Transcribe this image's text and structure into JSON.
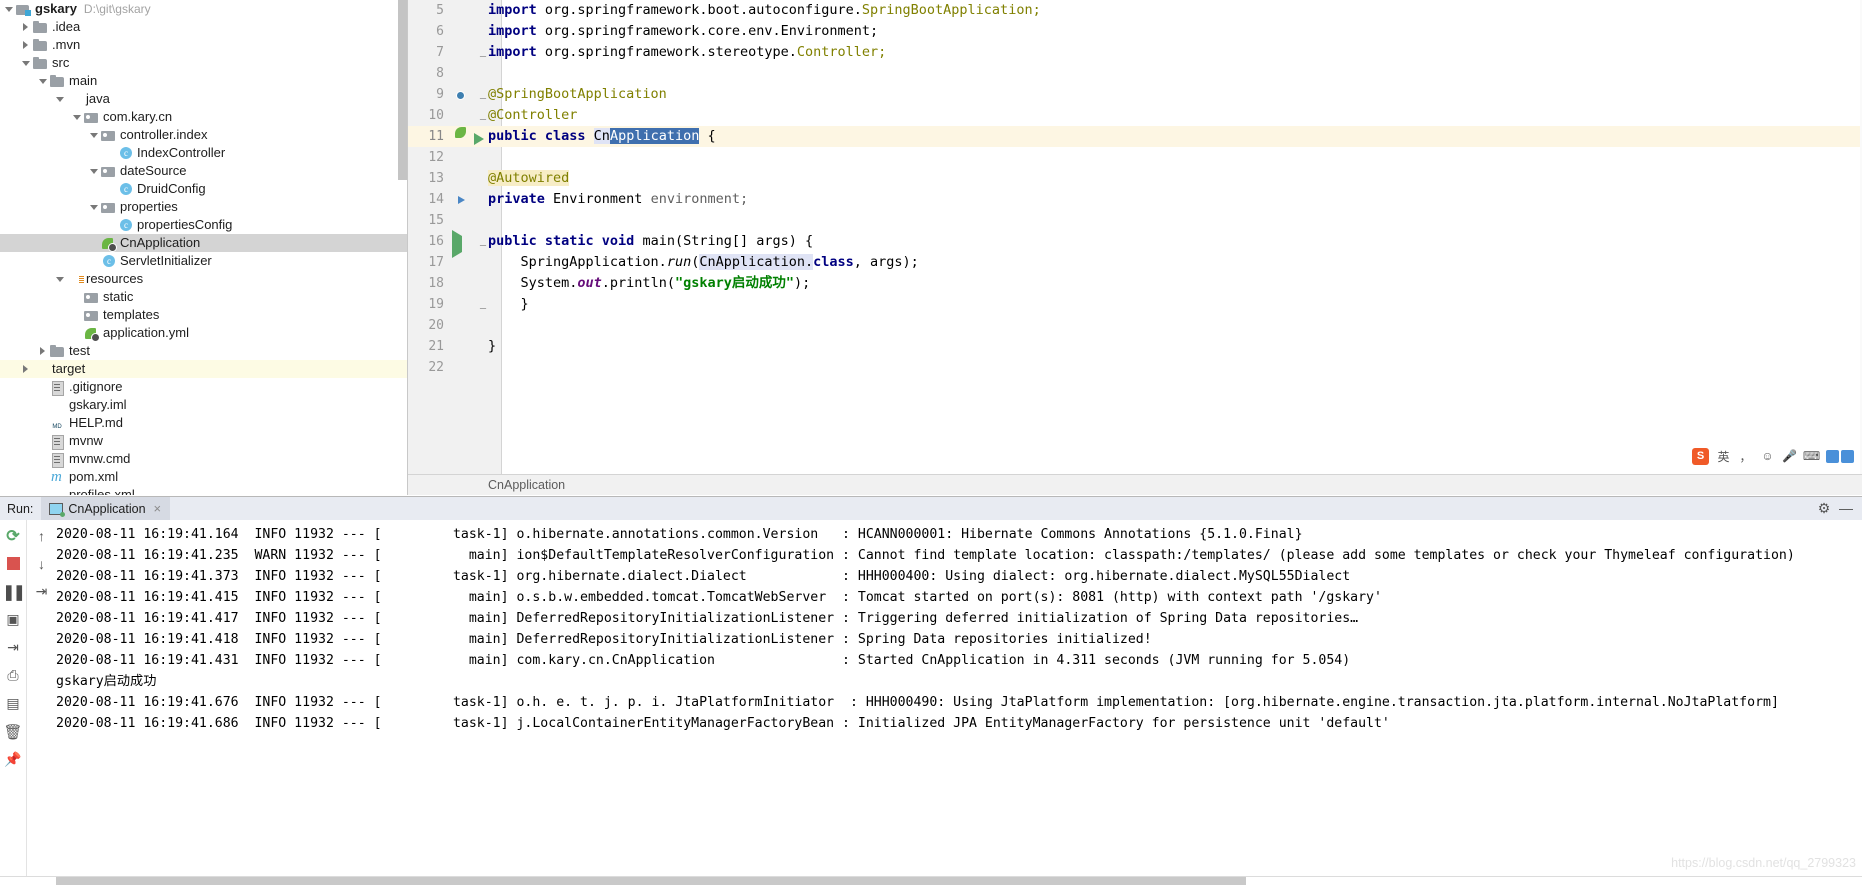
{
  "project": {
    "root_label": "gskary",
    "root_path": "D:\\git\\gskary",
    "items": [
      {
        "label": ".idea",
        "indent": 1,
        "arrow": "right",
        "icon": "folder",
        "state": "normal"
      },
      {
        "label": ".mvn",
        "indent": 1,
        "arrow": "right",
        "icon": "folder",
        "state": "normal"
      },
      {
        "label": "src",
        "indent": 1,
        "arrow": "down",
        "icon": "folder",
        "state": "normal"
      },
      {
        "label": "main",
        "indent": 2,
        "arrow": "down",
        "icon": "folder",
        "state": "normal"
      },
      {
        "label": "java",
        "indent": 3,
        "arrow": "down",
        "icon": "folder-src",
        "state": "normal"
      },
      {
        "label": "com.kary.cn",
        "indent": 4,
        "arrow": "down",
        "icon": "folder-pkg",
        "state": "normal"
      },
      {
        "label": "controller.index",
        "indent": 5,
        "arrow": "down",
        "icon": "folder-pkg",
        "state": "normal"
      },
      {
        "label": "IndexController",
        "indent": 6,
        "arrow": "none",
        "icon": "class",
        "state": "normal"
      },
      {
        "label": "dateSource",
        "indent": 5,
        "arrow": "down",
        "icon": "folder-pkg",
        "state": "normal"
      },
      {
        "label": "DruidConfig",
        "indent": 6,
        "arrow": "none",
        "icon": "class",
        "state": "normal"
      },
      {
        "label": "properties",
        "indent": 5,
        "arrow": "down",
        "icon": "folder-pkg",
        "state": "normal"
      },
      {
        "label": "propertiesConfig",
        "indent": 6,
        "arrow": "none",
        "icon": "class",
        "state": "normal"
      },
      {
        "label": "CnApplication",
        "indent": 5,
        "arrow": "none",
        "icon": "spring",
        "state": "selected"
      },
      {
        "label": "ServletInitializer",
        "indent": 5,
        "arrow": "none",
        "icon": "class",
        "state": "normal"
      },
      {
        "label": "resources",
        "indent": 3,
        "arrow": "down",
        "icon": "folder-res",
        "state": "normal"
      },
      {
        "label": "static",
        "indent": 4,
        "arrow": "none",
        "icon": "folder-pkg",
        "state": "normal"
      },
      {
        "label": "templates",
        "indent": 4,
        "arrow": "none",
        "icon": "folder-pkg",
        "state": "normal"
      },
      {
        "label": "application.yml",
        "indent": 4,
        "arrow": "none",
        "icon": "yml",
        "state": "normal"
      },
      {
        "label": "test",
        "indent": 2,
        "arrow": "right",
        "icon": "folder",
        "state": "normal"
      },
      {
        "label": "target",
        "indent": 1,
        "arrow": "right",
        "icon": "folder-target",
        "state": "highlight"
      },
      {
        "label": ".gitignore",
        "indent": 2,
        "arrow": "none",
        "icon": "file",
        "state": "normal"
      },
      {
        "label": "gskary.iml",
        "indent": 2,
        "arrow": "none",
        "icon": "file-iml",
        "state": "normal"
      },
      {
        "label": "HELP.md",
        "indent": 2,
        "arrow": "none",
        "icon": "file-md",
        "icon_text": "MD",
        "state": "normal"
      },
      {
        "label": "mvnw",
        "indent": 2,
        "arrow": "none",
        "icon": "file",
        "state": "normal"
      },
      {
        "label": "mvnw.cmd",
        "indent": 2,
        "arrow": "none",
        "icon": "file",
        "state": "normal"
      },
      {
        "label": "pom.xml",
        "indent": 2,
        "arrow": "none",
        "icon": "maven",
        "state": "normal"
      },
      {
        "label": "profiles.xml",
        "indent": 2,
        "arrow": "none",
        "icon": "file-xml",
        "icon_text": "<>",
        "state": "normal"
      }
    ]
  },
  "editor": {
    "breadcrumb": "CnApplication",
    "lines": [
      {
        "num": "5",
        "marker": "",
        "fold": "",
        "highlight": false
      },
      {
        "num": "6",
        "marker": "",
        "fold": "",
        "highlight": false
      },
      {
        "num": "7",
        "marker": "",
        "fold": "-",
        "highlight": false
      },
      {
        "num": "8",
        "marker": "",
        "fold": "",
        "highlight": false
      },
      {
        "num": "9",
        "marker": "bean",
        "fold": "-",
        "highlight": false
      },
      {
        "num": "10",
        "marker": "",
        "fold": "-",
        "highlight": false
      },
      {
        "num": "11",
        "marker": "spring-run",
        "fold": "",
        "highlight": true
      },
      {
        "num": "12",
        "marker": "",
        "fold": "",
        "highlight": false
      },
      {
        "num": "13",
        "marker": "",
        "fold": "",
        "highlight": false
      },
      {
        "num": "14",
        "marker": "autowire",
        "fold": "",
        "highlight": false
      },
      {
        "num": "15",
        "marker": "",
        "fold": "",
        "highlight": false
      },
      {
        "num": "16",
        "marker": "play",
        "fold": "-",
        "highlight": false
      },
      {
        "num": "17",
        "marker": "",
        "fold": "",
        "highlight": false
      },
      {
        "num": "18",
        "marker": "",
        "fold": "",
        "highlight": false
      },
      {
        "num": "19",
        "marker": "",
        "fold": "-",
        "highlight": false
      },
      {
        "num": "20",
        "marker": "",
        "fold": "",
        "highlight": false
      },
      {
        "num": "21",
        "marker": "",
        "fold": "",
        "highlight": false
      },
      {
        "num": "22",
        "marker": "",
        "fold": "",
        "highlight": false
      }
    ],
    "code": {
      "l5_kw": "import",
      "l5_pkg": " org.springframework.boot.autoconfigure.",
      "l5_cls": "SpringBootApplication;",
      "l6_kw": "import",
      "l6_pkg": " org.springframework.core.env.",
      "l6_cls": "Environment;",
      "l7_kw": "import",
      "l7_pkg": " org.springframework.stereotype.",
      "l7_cls": "Controller;",
      "l9_ann": "@SpringBootApplication",
      "l10_ann": "@Controller",
      "l11_kw": "public class ",
      "l11_name_pre": "Cn",
      "l11_name_sel": "Application",
      "l11_brace": " {",
      "l13_ann": "@Autowired",
      "l14_kw": "private ",
      "l14_type": "Environment ",
      "l14_var": "environment;",
      "l16_kw": "public static void ",
      "l16_sig": "main(String[] args) {",
      "l17_a": "    SpringApplication.",
      "l17_run": "run",
      "l17_b": "(",
      "l17_cls": "CnApplication.",
      "l17_kw": "class",
      "l17_c": ", args);",
      "l18_a": "    System.",
      "l18_out": "out",
      "l18_b": ".println(",
      "l18_str": "\"gskary启动成功\"",
      "l18_c": ");",
      "l19": "    }",
      "l21": "}"
    },
    "ime": {
      "logo": "S",
      "mode_label": "英",
      "punct": "，",
      "emoji": "☺",
      "mic": "🎤",
      "keyboard": "⌨",
      "tools": "▦"
    }
  },
  "run_panel": {
    "run_label": "Run:",
    "tab_label": "CnApplication",
    "tab_close": "×",
    "gear": "⚙",
    "minimize": "—",
    "toolbar": {
      "rerun": "⟳",
      "stop": "■",
      "pause": "❚❚",
      "camera": "▣",
      "export": "⇥",
      "print": "⎙",
      "grid": "▤",
      "trash": "🗑",
      "pin": "📌",
      "scroll_up": "↑",
      "scroll_down": "↓",
      "soft_wrap": "⇥"
    },
    "console_lines": [
      "2020-08-11 16:19:41.164  INFO 11932 --- [         task-1] o.hibernate.annotations.common.Version   : HCANN000001: Hibernate Commons Annotations {5.1.0.Final}",
      "2020-08-11 16:19:41.235  WARN 11932 --- [           main] ion$DefaultTemplateResolverConfiguration : Cannot find template location: classpath:/templates/ (please add some templates or check your Thymeleaf configuration)",
      "2020-08-11 16:19:41.373  INFO 11932 --- [         task-1] org.hibernate.dialect.Dialect            : HHH000400: Using dialect: org.hibernate.dialect.MySQL55Dialect",
      "2020-08-11 16:19:41.415  INFO 11932 --- [           main] o.s.b.w.embedded.tomcat.TomcatWebServer  : Tomcat started on port(s): 8081 (http) with context path '/gskary'",
      "2020-08-11 16:19:41.417  INFO 11932 --- [           main] DeferredRepositoryInitializationListener : Triggering deferred initialization of Spring Data repositories…",
      "2020-08-11 16:19:41.418  INFO 11932 --- [           main] DeferredRepositoryInitializationListener : Spring Data repositories initialized!",
      "2020-08-11 16:19:41.431  INFO 11932 --- [           main] com.kary.cn.CnApplication                : Started CnApplication in 4.311 seconds (JVM running for 5.054)",
      "gskary启动成功",
      "2020-08-11 16:19:41.676  INFO 11932 --- [         task-1] o.h. e. t. j. p. i. JtaPlatformInitiator  : HHH000490: Using JtaPlatform implementation: [org.hibernate.engine.transaction.jta.platform.internal.NoJtaPlatform]",
      "2020-08-11 16:19:41.686  INFO 11932 --- [         task-1] j.LocalContainerEntityManagerFactoryBean : Initialized JPA EntityManagerFactory for persistence unit 'default'"
    ]
  },
  "watermark": "https://blog.csdn.net/qq_2799323"
}
